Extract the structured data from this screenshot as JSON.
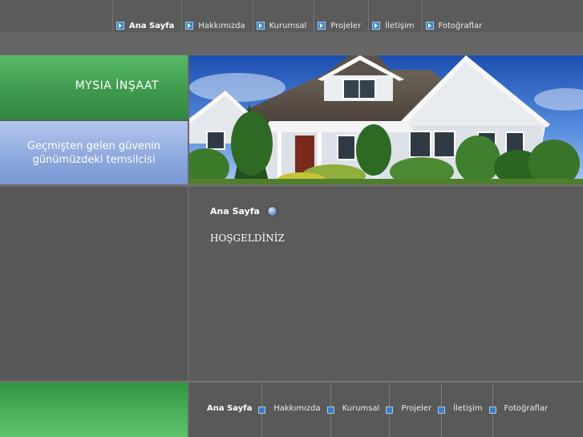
{
  "nav": {
    "items": [
      {
        "label": "Ana Sayfa",
        "active": true
      },
      {
        "label": "Hakkımızda",
        "active": false
      },
      {
        "label": "Kurumsal",
        "active": false
      },
      {
        "label": "Projeler",
        "active": false
      },
      {
        "label": "İletişim",
        "active": false
      },
      {
        "label": "Fotoğraflar",
        "active": false
      }
    ]
  },
  "brand": {
    "name": "MYSIA İNŞAAT"
  },
  "slogan": {
    "line1": "Geçmişten gelen güvenin",
    "line2": "günümüzdeki temsilcisi"
  },
  "content": {
    "breadcrumb": "Ana Sayfa",
    "heading": "HOŞGELDİNİZ"
  },
  "footer": {
    "items": [
      {
        "label": "Ana Sayfa",
        "active": true
      },
      {
        "label": "Hakkımızda",
        "active": false
      },
      {
        "label": "Kurumsal",
        "active": false
      },
      {
        "label": "Projeler",
        "active": false
      },
      {
        "label": "İletişim",
        "active": false
      },
      {
        "label": "Fotoğraflar",
        "active": false
      }
    ]
  },
  "colors": {
    "background": "#5a5a5a",
    "green": "#3f9a4f",
    "slogan_blue": "#8ca7de",
    "nav_bullet": "#3b86c8"
  }
}
